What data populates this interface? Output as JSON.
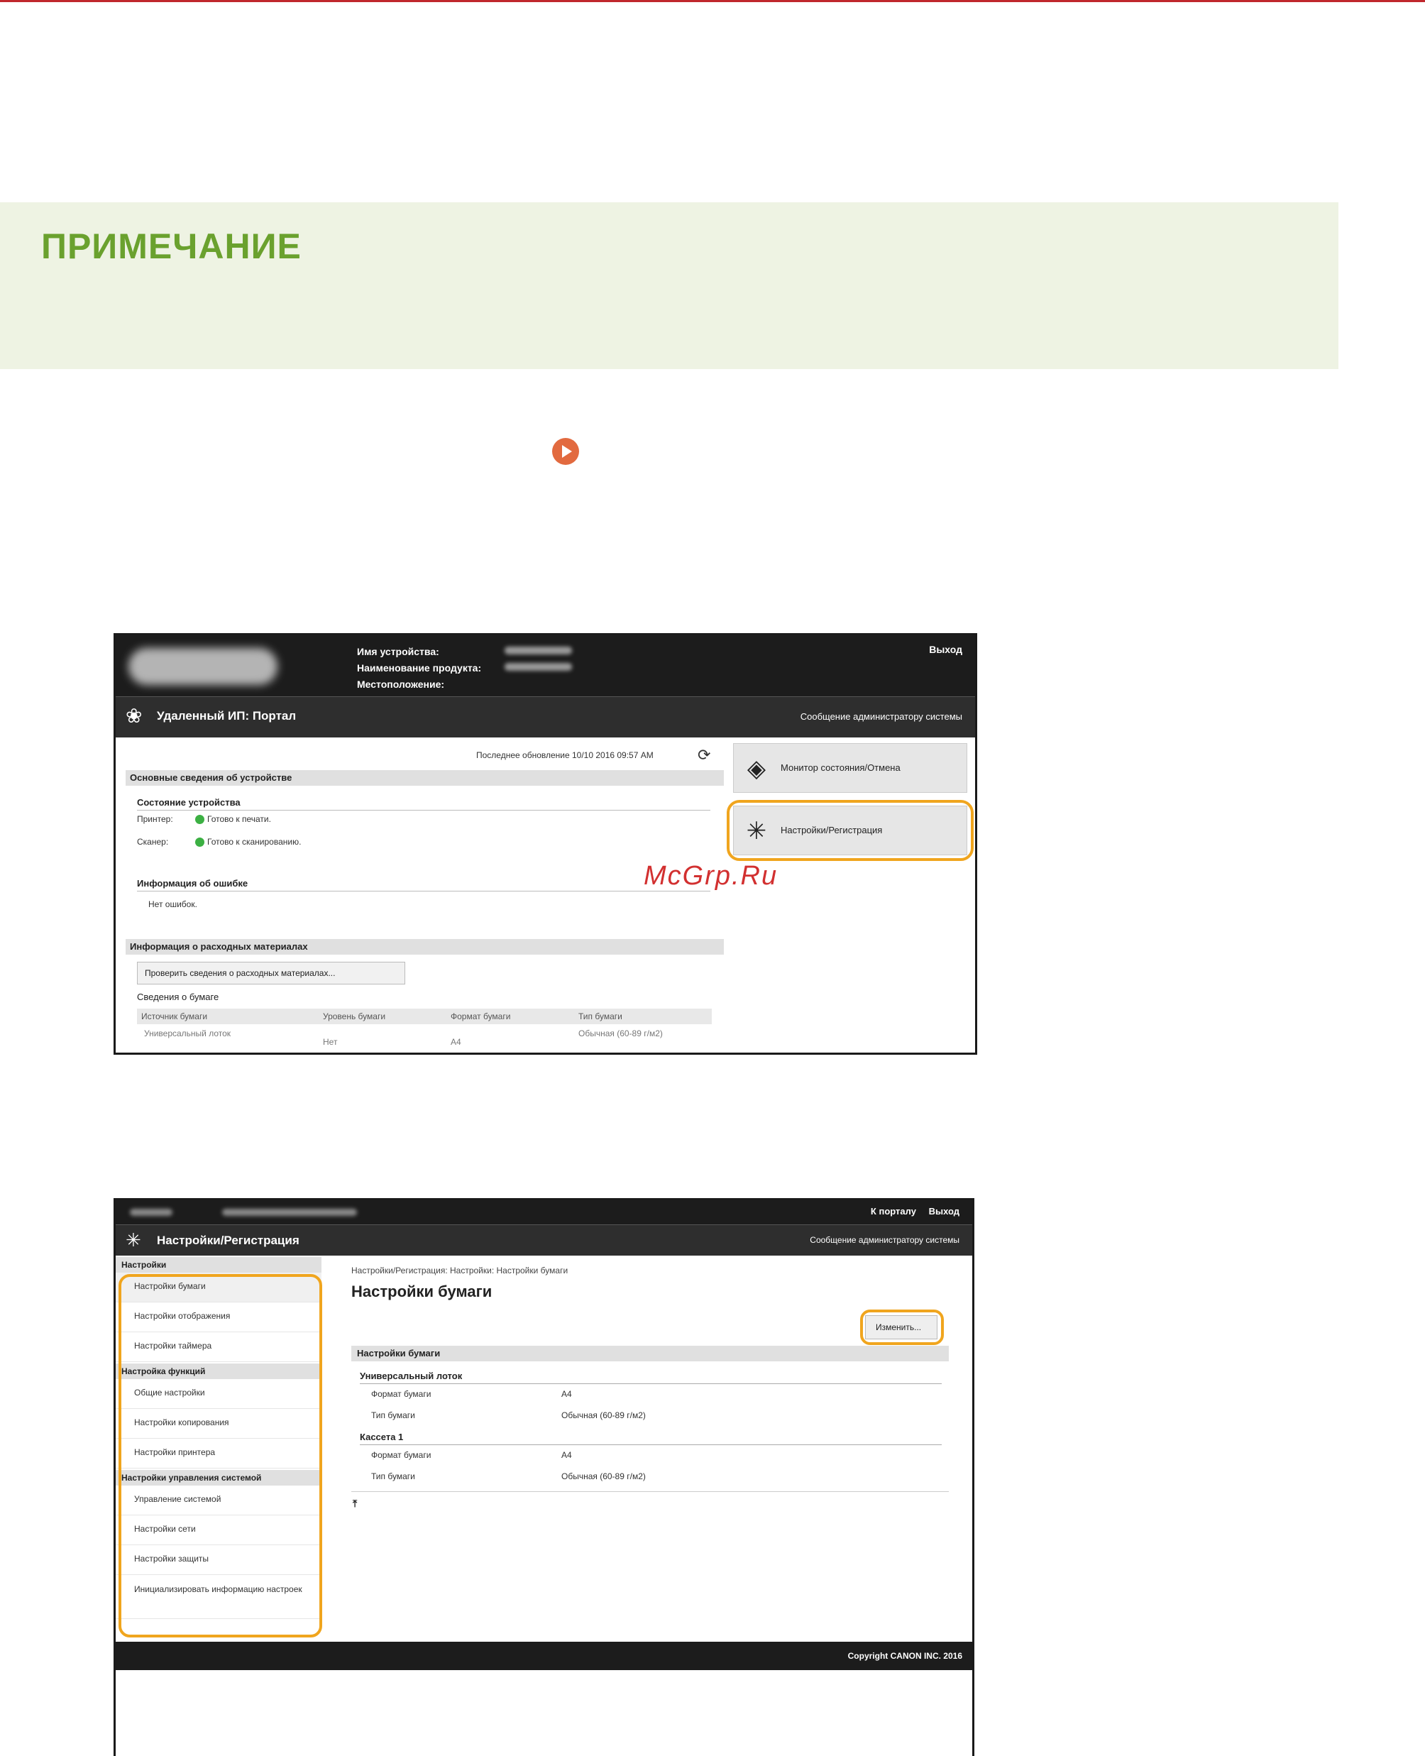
{
  "note": {
    "title": "ПРИМЕЧАНИЕ"
  },
  "watermark": "McGrp.Ru",
  "portal": {
    "device_name_label": "Имя устройства:",
    "product_name_label": "Наименование продукта:",
    "location_label": "Местоположение:",
    "logout": "Выход",
    "title": "Удаленный ИП: Портал",
    "admin_message": "Сообщение администратору системы",
    "last_updated": "Последнее обновление 10/10 2016 09:57 AM",
    "basic_info_title": "Основные сведения об устройстве",
    "device_status_title": "Состояние устройства",
    "printer_label": "Принтер:",
    "printer_status": "Готово к печати.",
    "scanner_label": "Сканер:",
    "scanner_status": "Готово к сканированию.",
    "error_info_title": "Информация об ошибке",
    "error_info_value": "Нет ошибок.",
    "consumables_title": "Информация о расходных материалах",
    "check_consumables_button": "Проверить сведения о расходных материалах...",
    "paper_info_title": "Сведения о бумаге",
    "paper_table": {
      "headers": [
        "Источник бумаги",
        "Уровень бумаги",
        "Формат бумаги",
        "Тип бумаги"
      ],
      "row": [
        "Универсальный лоток",
        "Нет",
        "A4",
        "Обычная (60-89 г/м2)"
      ]
    },
    "tile_monitor": "Монитор состояния/Отмена",
    "tile_settings": "Настройки/Регистрация"
  },
  "settings": {
    "to_portal": "К порталу",
    "logout": "Выход",
    "title": "Настройки/Регистрация",
    "admin_message": "Сообщение администратору системы",
    "sidebar": {
      "group1": "Настройки",
      "items1": [
        "Настройки бумаги",
        "Настройки отображения",
        "Настройки таймера"
      ],
      "group2": "Настройка функций",
      "items2": [
        "Общие настройки",
        "Настройки копирования",
        "Настройки принтера"
      ],
      "group3": "Настройки управления системой",
      "items3": [
        "Управление системой",
        "Настройки сети",
        "Настройки защиты",
        "Инициализировать информацию настроек"
      ]
    },
    "breadcrumb": "Настройки/Регистрация: Настройки: Настройки бумаги",
    "page_title": "Настройки бумаги",
    "edit_button": "Изменить...",
    "section_title": "Настройки бумаги",
    "mp_tray": "Универсальный лоток",
    "cassette1": "Кассета 1",
    "paper_size_label": "Формат бумаги",
    "paper_type_label": "Тип бумаги",
    "paper_size_value": "A4",
    "paper_type_value": "Обычная (60-89 г/м2)",
    "copyright": "Copyright CANON INC. 2016"
  }
}
